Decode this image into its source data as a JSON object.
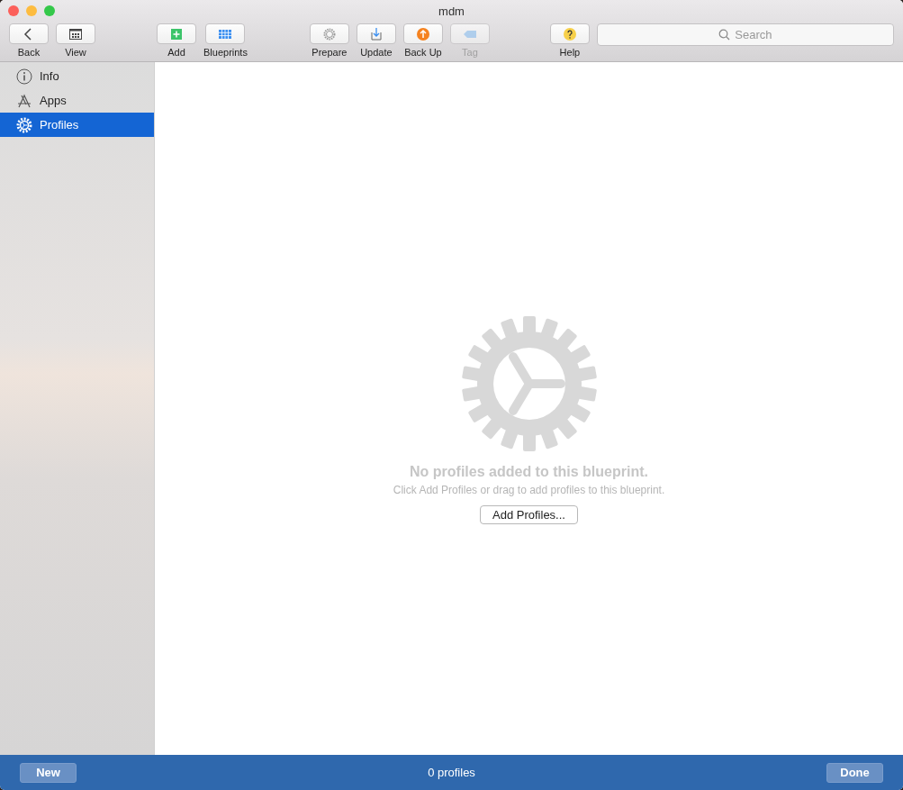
{
  "window": {
    "title": "mdm"
  },
  "toolbar": {
    "groups": [
      {
        "items": [
          {
            "kind": "back",
            "label": "Back",
            "disabled": false
          },
          {
            "kind": "view",
            "label": "View",
            "disabled": false
          }
        ]
      },
      {
        "items": [
          {
            "kind": "add",
            "label": "Add",
            "disabled": false
          },
          {
            "kind": "blueprints",
            "label": "Blueprints",
            "disabled": false
          }
        ]
      },
      {
        "items": [
          {
            "kind": "prepare",
            "label": "Prepare",
            "disabled": false
          },
          {
            "kind": "update",
            "label": "Update",
            "disabled": false
          },
          {
            "kind": "backup",
            "label": "Back Up",
            "disabled": false
          },
          {
            "kind": "tag",
            "label": "Tag",
            "disabled": true
          }
        ]
      },
      {
        "items": [
          {
            "kind": "help",
            "label": "Help",
            "disabled": false
          }
        ]
      }
    ]
  },
  "search": {
    "placeholder": "Search"
  },
  "sidebar": {
    "items": [
      {
        "kind": "info",
        "label": "Info",
        "selected": false
      },
      {
        "kind": "apps",
        "label": "Apps",
        "selected": false
      },
      {
        "kind": "profiles",
        "label": "Profiles",
        "selected": true
      }
    ]
  },
  "empty_state": {
    "title": "No profiles added to this blueprint.",
    "subtitle": "Click Add Profiles or drag to add profiles to this blueprint.",
    "button": "Add Profiles..."
  },
  "footer": {
    "left_button": "New",
    "status": "0 profiles",
    "right_button": "Done"
  }
}
